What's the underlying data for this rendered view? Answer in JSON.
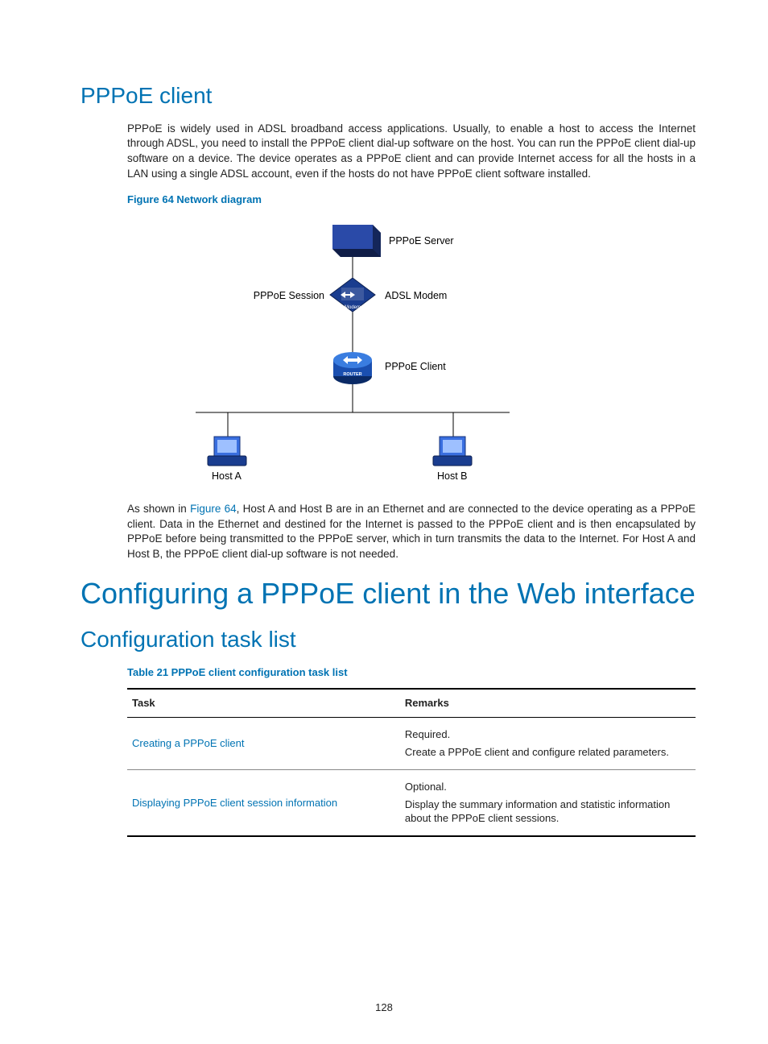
{
  "headings": {
    "pppoe_client": "PPPoE client",
    "configuring": "Configuring a PPPoE client in the Web interface",
    "config_task_list": "Configuration task list"
  },
  "paragraphs": {
    "p1": "PPPoE is widely used in ADSL broadband access applications. Usually, to enable a host to access the Internet through ADSL, you need to install the PPPoE client dial-up software on the host. You can run the PPPoE client dial-up software on a device. The device operates as a PPPoE client and can provide Internet access for all the hosts in a LAN using a single ADSL account, even if the hosts do not have PPPoE client software installed.",
    "p2_pre": "As shown in ",
    "p2_link": "Figure 64",
    "p2_post": ", Host A and Host B are in an Ethernet and are connected to the device operating as a PPPoE client. Data in the Ethernet and destined for the Internet is passed to the PPPoE client and is then encapsulated by PPPoE before being transmitted to the PPPoE server, which in turn transmits the data to the Internet. For Host A and Host B, the PPPoE client dial-up software is not needed."
  },
  "captions": {
    "figure": "Figure 64 Network diagram",
    "table": "Table 21 PPPoE client configuration task list"
  },
  "diagram": {
    "server": "PPPoE Server",
    "session": "PPPoE Session",
    "modem": "ADSL Modem",
    "client": "PPPoE Client",
    "hostA": "Host A",
    "hostB": "Host B",
    "modem_tag": "Modem",
    "router_tag": "ROUTER"
  },
  "table": {
    "headers": {
      "task": "Task",
      "remarks": "Remarks"
    },
    "rows": [
      {
        "task": "Creating a PPPoE client",
        "remarks_req": "Required.",
        "remarks_desc": "Create a PPPoE client and configure related parameters."
      },
      {
        "task": "Displaying PPPoE client session information",
        "remarks_req": "Optional.",
        "remarks_desc": "Display the summary information and statistic information about the PPPoE client sessions."
      }
    ]
  },
  "page_number": "128"
}
